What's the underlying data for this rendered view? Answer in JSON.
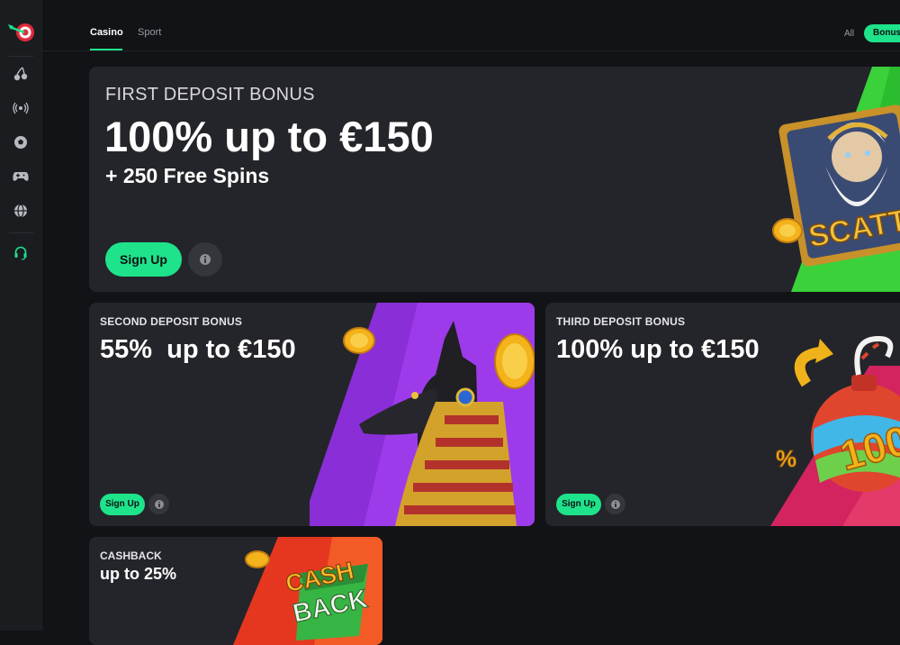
{
  "nav": {
    "tabs": [
      {
        "label": "Casino",
        "active": true
      },
      {
        "label": "Sport",
        "active": false
      }
    ],
    "filters": {
      "all": "All",
      "bonuses": "Bonuses"
    }
  },
  "sidebar": {
    "items": [
      {
        "icon": "cherry-icon"
      },
      {
        "icon": "live-broadcast-icon"
      },
      {
        "icon": "soccer-ball-icon"
      },
      {
        "icon": "gamepad-icon"
      },
      {
        "icon": "globe-icon"
      },
      {
        "icon": "support-headset-icon"
      }
    ]
  },
  "bonuses": {
    "first": {
      "label": "FIRST DEPOSIT BONUS",
      "title": "100% up to €150",
      "subtitle": "+ 250 Free Spins",
      "cta": "Sign Up",
      "art_text": "SCATT"
    },
    "second": {
      "label": "SECOND DEPOSIT BONUS",
      "title": "55%  up to €150",
      "cta": "Sign Up"
    },
    "third": {
      "label": "THIRD DEPOSIT BONUS",
      "title": "100% up to €150",
      "cta": "Sign Up",
      "art_text": "100",
      "art_percent": "%"
    },
    "cashback": {
      "label": "CASHBACK",
      "title": "up to 25%",
      "art_text_1": "CASH",
      "art_text_2": "BACK"
    }
  },
  "colors": {
    "accent": "#1ee38b",
    "card": "#24252a",
    "background": "#121316"
  }
}
